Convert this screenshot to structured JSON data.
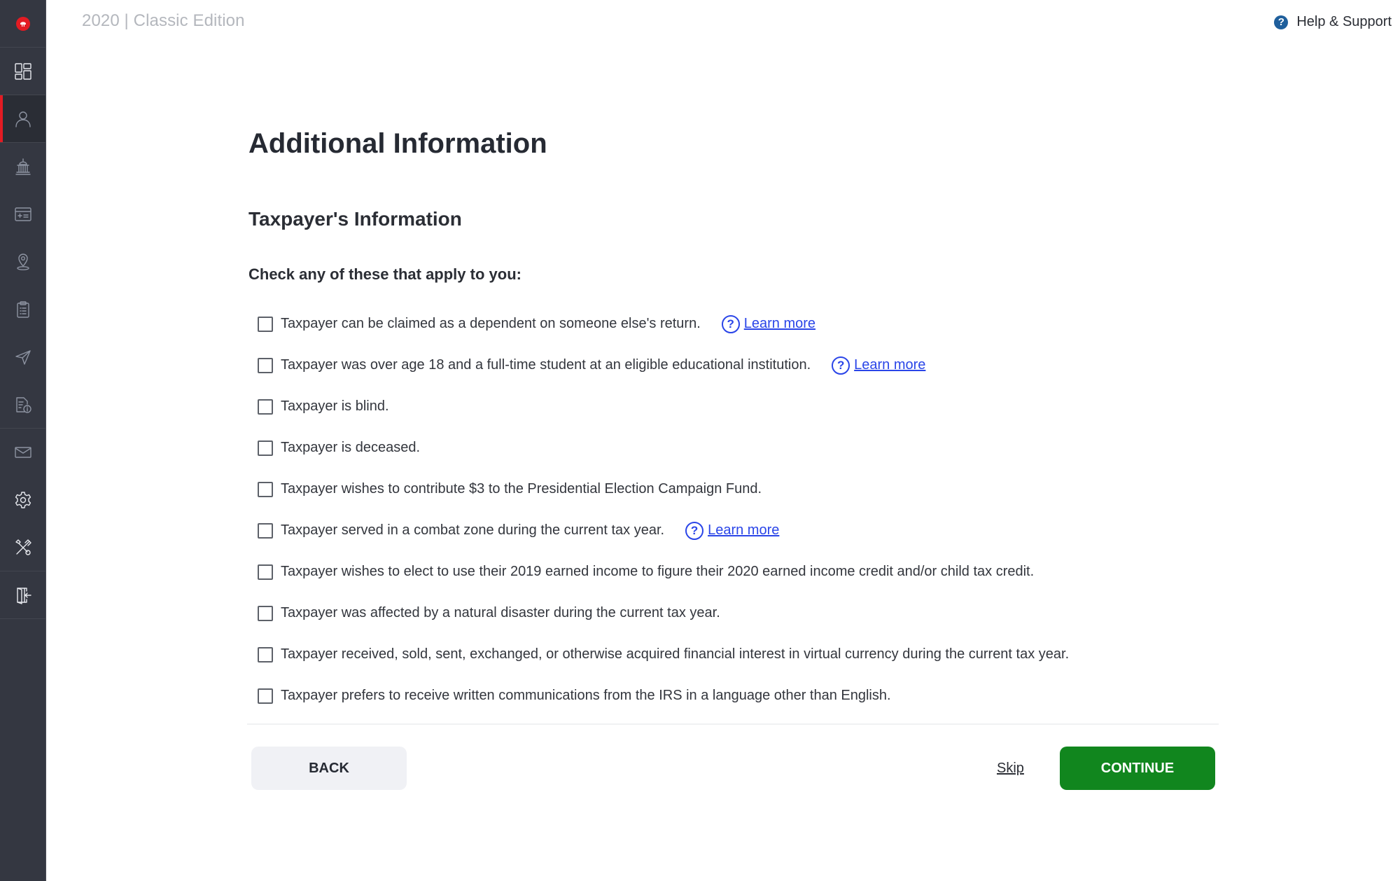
{
  "app": {
    "title": "2020 | Classic Edition",
    "help_label": "Help & Support",
    "help_icon": "question-circle-icon"
  },
  "sidebar": {
    "items": [
      {
        "id": "logo",
        "icon": "helmet-logo-icon",
        "active": false
      },
      {
        "id": "dashboard",
        "icon": "dashboard-grid-icon",
        "active": false
      },
      {
        "id": "personal-info",
        "icon": "person-icon",
        "active": true
      },
      {
        "id": "federal",
        "icon": "capitol-building-icon",
        "active": false
      },
      {
        "id": "state",
        "icon": "calculator-card-icon",
        "active": false
      },
      {
        "id": "location",
        "icon": "map-pin-icon",
        "active": false
      },
      {
        "id": "summary",
        "icon": "clipboard-list-icon",
        "active": false
      },
      {
        "id": "filing",
        "icon": "send-arrow-icon",
        "active": false
      },
      {
        "id": "documents",
        "icon": "document-info-icon",
        "active": false
      },
      {
        "id": "messages",
        "icon": "envelope-icon",
        "active": false
      },
      {
        "id": "settings",
        "icon": "gear-icon",
        "active": false
      },
      {
        "id": "tools",
        "icon": "tools-icon",
        "active": false
      },
      {
        "id": "sign-out",
        "icon": "sign-out-door-icon",
        "active": false
      }
    ]
  },
  "page": {
    "title": "Additional Information",
    "section_title": "Taxpayer's Information",
    "prompt": "Check any of these that apply to you:",
    "learn_more_label": "Learn more",
    "options": [
      {
        "label": "Taxpayer can be claimed as a dependent on someone else's return.",
        "checked": false,
        "learn_more": true
      },
      {
        "label": "Taxpayer was over age 18 and a full-time student at an eligible educational institution.",
        "checked": false,
        "learn_more": true
      },
      {
        "label": "Taxpayer is blind.",
        "checked": false,
        "learn_more": false
      },
      {
        "label": "Taxpayer is deceased.",
        "checked": false,
        "learn_more": false
      },
      {
        "label": "Taxpayer wishes to contribute $3 to the Presidential Election Campaign Fund.",
        "checked": false,
        "learn_more": false
      },
      {
        "label": "Taxpayer served in a combat zone during the current tax year.",
        "checked": false,
        "learn_more": true
      },
      {
        "label": "Taxpayer wishes to elect to use their 2019 earned income to figure their 2020 earned income credit and/or child tax credit.",
        "checked": false,
        "learn_more": false
      },
      {
        "label": "Taxpayer was affected by a natural disaster during the current tax year.",
        "checked": false,
        "learn_more": false
      },
      {
        "label": "Taxpayer received, sold, sent, exchanged, or otherwise acquired financial interest in virtual currency during the current tax year.",
        "checked": false,
        "learn_more": false
      },
      {
        "label": "Taxpayer prefers to receive written communications from the IRS in a language other than English.",
        "checked": false,
        "learn_more": false
      }
    ]
  },
  "footer": {
    "back_label": "BACK",
    "skip_label": "Skip",
    "continue_label": "CONTINUE"
  },
  "colors": {
    "brand_red": "#e31b23",
    "continue_green": "#11861e",
    "link_blue": "#2a45e8",
    "sidebar_bg": "#343741"
  }
}
